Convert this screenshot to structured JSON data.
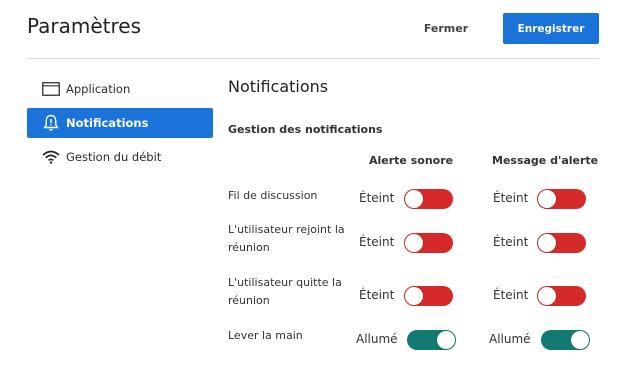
{
  "header": {
    "title": "Paramètres",
    "close_label": "Fermer",
    "save_label": "Enregistrer"
  },
  "sidebar": {
    "items": [
      {
        "label": "Application",
        "icon": "window-icon",
        "active": false
      },
      {
        "label": "Notifications",
        "icon": "bell-alert-icon",
        "active": true
      },
      {
        "label": "Gestion du débit",
        "icon": "wifi-icon",
        "active": false
      }
    ]
  },
  "main": {
    "title": "Notifications",
    "section_title": "Gestion des notifications",
    "columns": [
      "Alerte sonore",
      "Message d'alerte"
    ],
    "rows": [
      {
        "label": "Fil de discussion",
        "sound": {
          "state": "Éteint",
          "on": false
        },
        "message": {
          "state": "Éteint",
          "on": false
        }
      },
      {
        "label": "L'utilisateur rejoint la réunion",
        "sound": {
          "state": "Éteint",
          "on": false
        },
        "message": {
          "state": "Éteint",
          "on": false
        }
      },
      {
        "label": "L'utilisateur quitte la réunion",
        "sound": {
          "state": "Éteint",
          "on": false
        },
        "message": {
          "state": "Éteint",
          "on": false
        }
      },
      {
        "label": "Lever la main",
        "sound": {
          "state": "Allumé",
          "on": true
        },
        "message": {
          "state": "Allumé",
          "on": true
        }
      }
    ]
  },
  "colors": {
    "accent": "#1a73d9",
    "toggle_off": "#d52a2a",
    "toggle_on": "#137a72"
  }
}
